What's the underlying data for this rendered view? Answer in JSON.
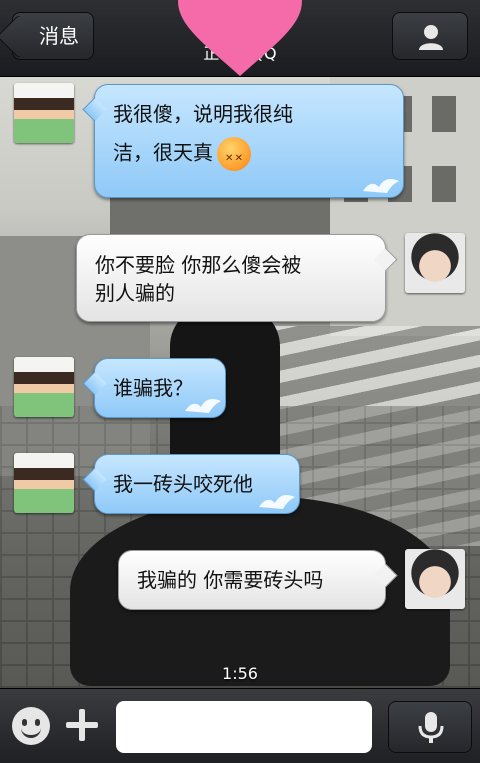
{
  "header": {
    "back_label": "消息",
    "title": "正在…QQ",
    "icons": {
      "back": "chevron-left-icon",
      "profile": "person-icon",
      "decoration": "heart-icon"
    }
  },
  "messages": [
    {
      "side": "left",
      "avatar": "boy-avatar",
      "text_line1": "我很傻，说明我很纯",
      "text_line2": "洁，很天真",
      "emoji": "dizzy-face-emoji"
    },
    {
      "side": "right",
      "avatar": "girl-avatar",
      "text_line1": "你不要脸  你那么傻会被",
      "text_line2": "别人骗的"
    },
    {
      "side": "left",
      "avatar": "boy-avatar",
      "text": "谁骗我？"
    },
    {
      "side": "left",
      "avatar": "boy-avatar",
      "text": "我一砖头咬死他"
    },
    {
      "side": "right",
      "avatar": "girl-avatar",
      "text": "我骗的  你需要砖头吗"
    }
  ],
  "timestamp": "1:56",
  "input_bar": {
    "placeholder": "",
    "icons": {
      "emoji": "smiley-icon",
      "plus": "plus-icon",
      "voice": "microphone-icon"
    }
  },
  "colors": {
    "bubble_blue": "#a9d6fb",
    "bubble_white": "#f2f2f2",
    "titlebar": "#25272b"
  }
}
